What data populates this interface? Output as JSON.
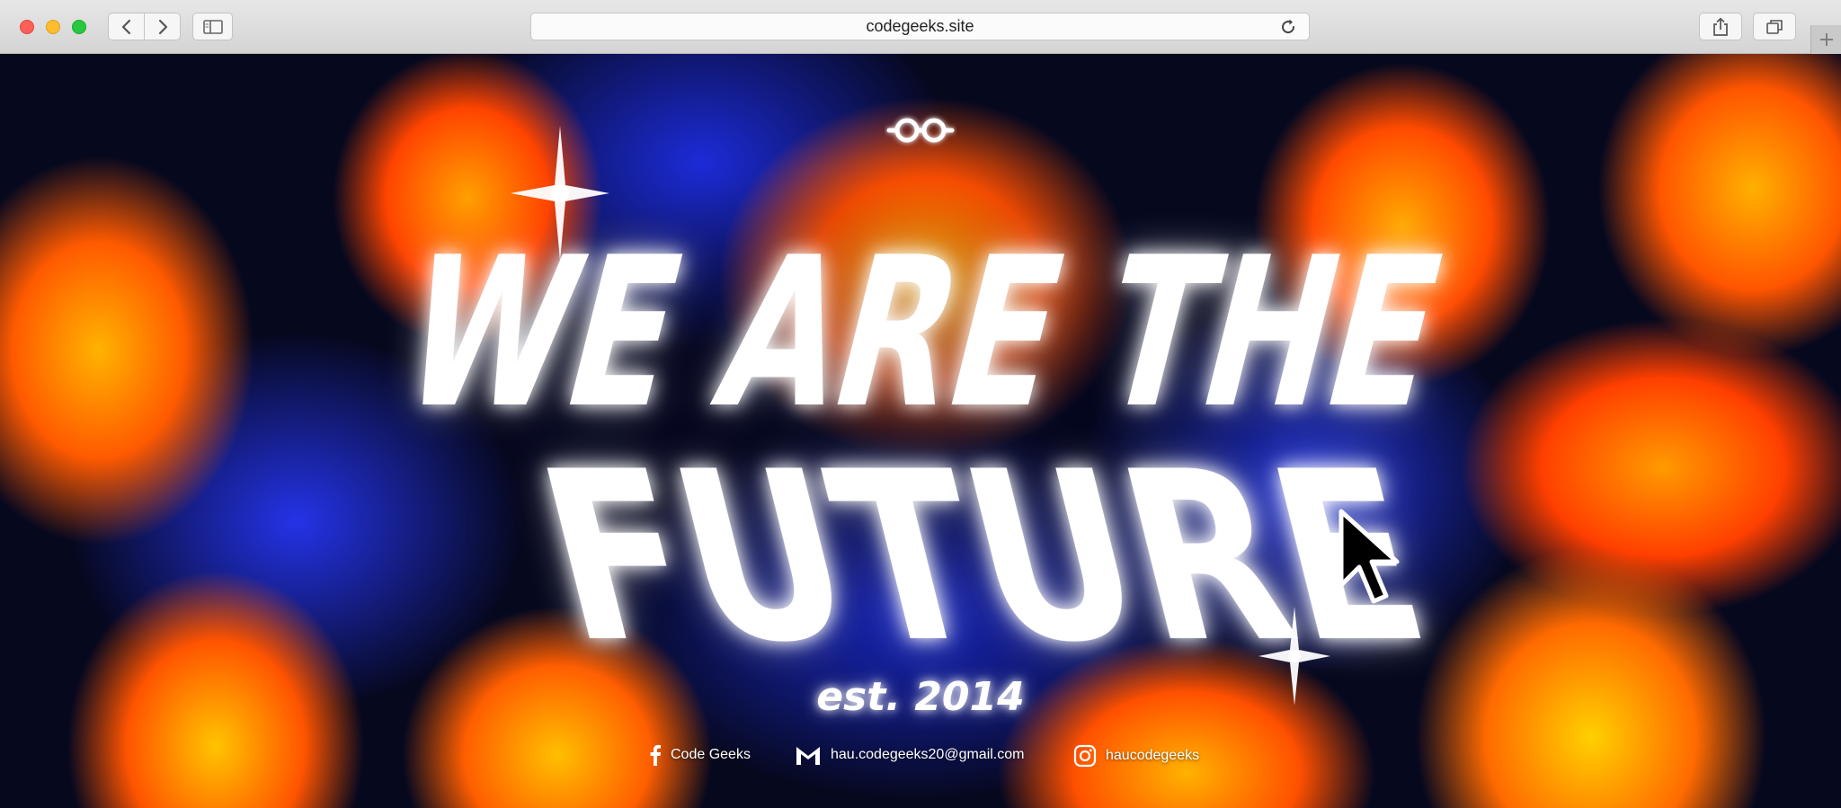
{
  "browser": {
    "url": "codegeeks.site"
  },
  "hero": {
    "headline_line1": "WE ARE THE",
    "headline_line2": "FUTURE",
    "tagline": "est. 2014"
  },
  "socials": [
    {
      "label": "Code Geeks",
      "icon": "facebook-icon"
    },
    {
      "label": "hau.codegeeks20@gmail.com",
      "icon": "gmail-icon"
    },
    {
      "label": "haucodegeeks",
      "icon": "instagram-icon"
    }
  ],
  "colors": {
    "headline": "#ffffff",
    "hot": "#ff5a00",
    "warm": "#ffb300",
    "cool": "#2433e8",
    "dark": "#06081e"
  }
}
